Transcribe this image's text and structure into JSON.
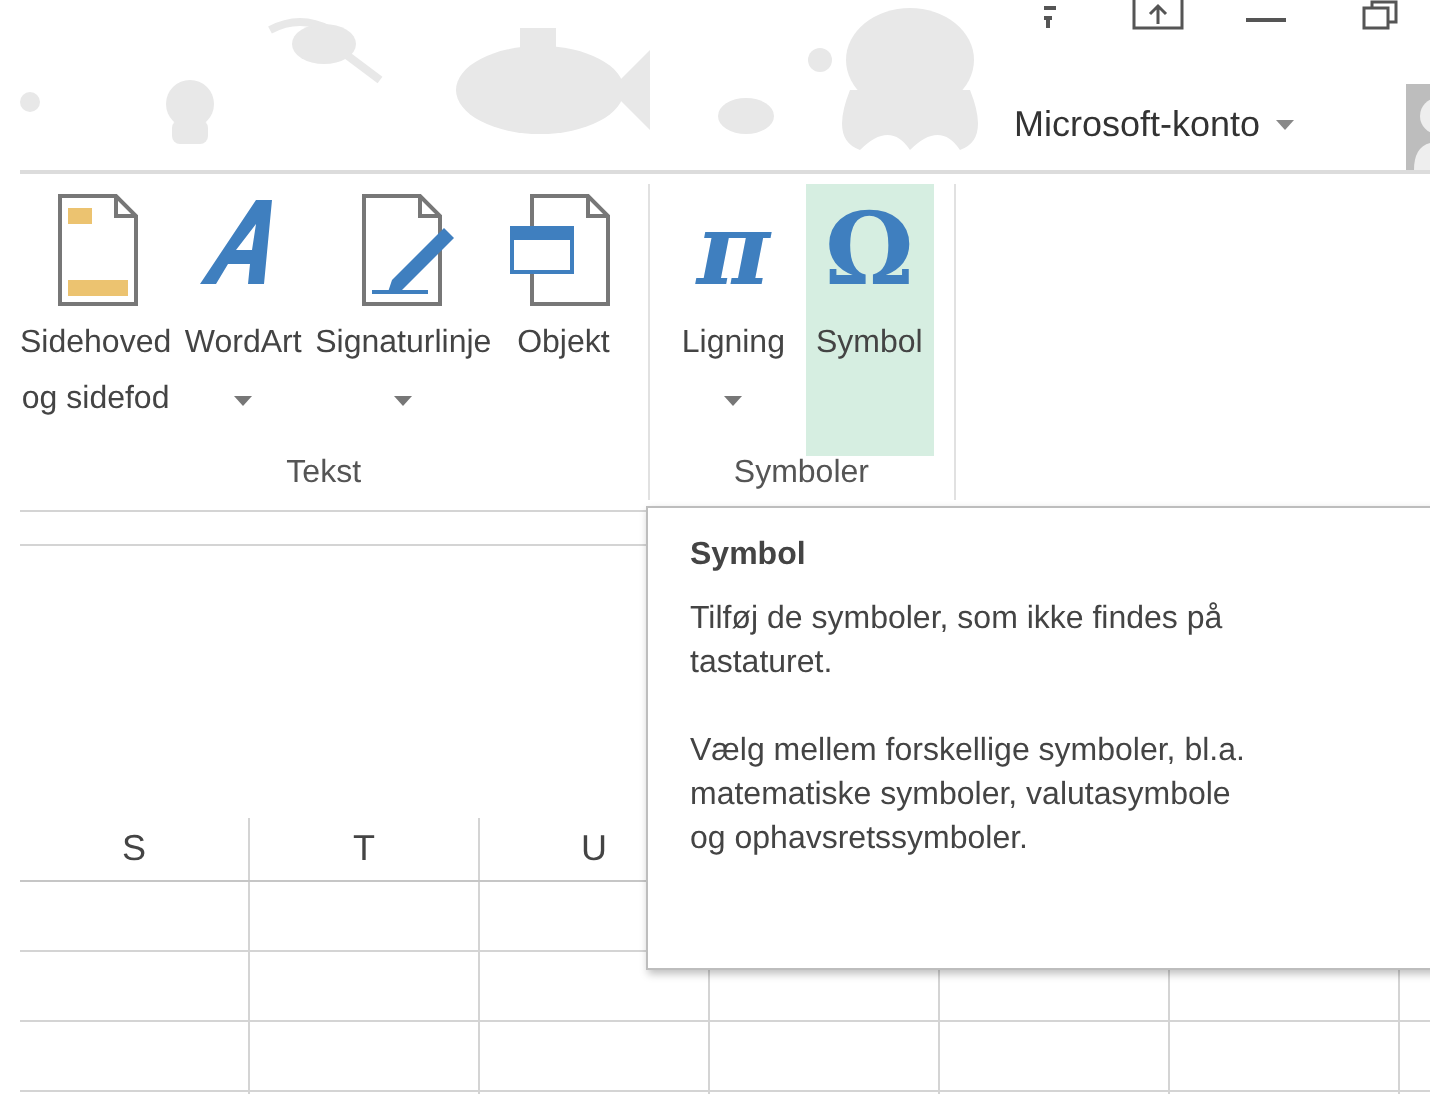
{
  "account": {
    "label": "Microsoft-konto"
  },
  "ribbon": {
    "groups": [
      {
        "label": "Tekst",
        "buttons": [
          {
            "kind": "header-footer",
            "lines": [
              "Sidehoved",
              "og sidefod"
            ],
            "has_dropdown": false,
            "highlighted": false
          },
          {
            "kind": "wordart",
            "lines": [
              "WordArt"
            ],
            "has_dropdown": true,
            "highlighted": false
          },
          {
            "kind": "signature",
            "lines": [
              "Signaturlinje"
            ],
            "has_dropdown": true,
            "highlighted": false
          },
          {
            "kind": "object",
            "lines": [
              "Objekt"
            ],
            "has_dropdown": false,
            "highlighted": false
          }
        ]
      },
      {
        "label": "Symboler",
        "buttons": [
          {
            "kind": "equation",
            "glyph": "π",
            "lines": [
              "Ligning"
            ],
            "has_dropdown": true,
            "highlighted": false
          },
          {
            "kind": "symbol",
            "glyph": "Ω",
            "lines": [
              "Symbol"
            ],
            "has_dropdown": false,
            "highlighted": true
          }
        ]
      }
    ]
  },
  "sheet": {
    "columns": [
      "S",
      "T",
      "U"
    ]
  },
  "tooltip": {
    "title": "Symbol",
    "paragraphs": [
      [
        "Tilføj de symboler, som ikke findes på",
        "tastaturet."
      ],
      [
        "Vælg mellem forskellige symboler, bl.a.",
        "matematiske symboler, valutasymbole",
        "og ophavsretssymboler."
      ]
    ]
  }
}
